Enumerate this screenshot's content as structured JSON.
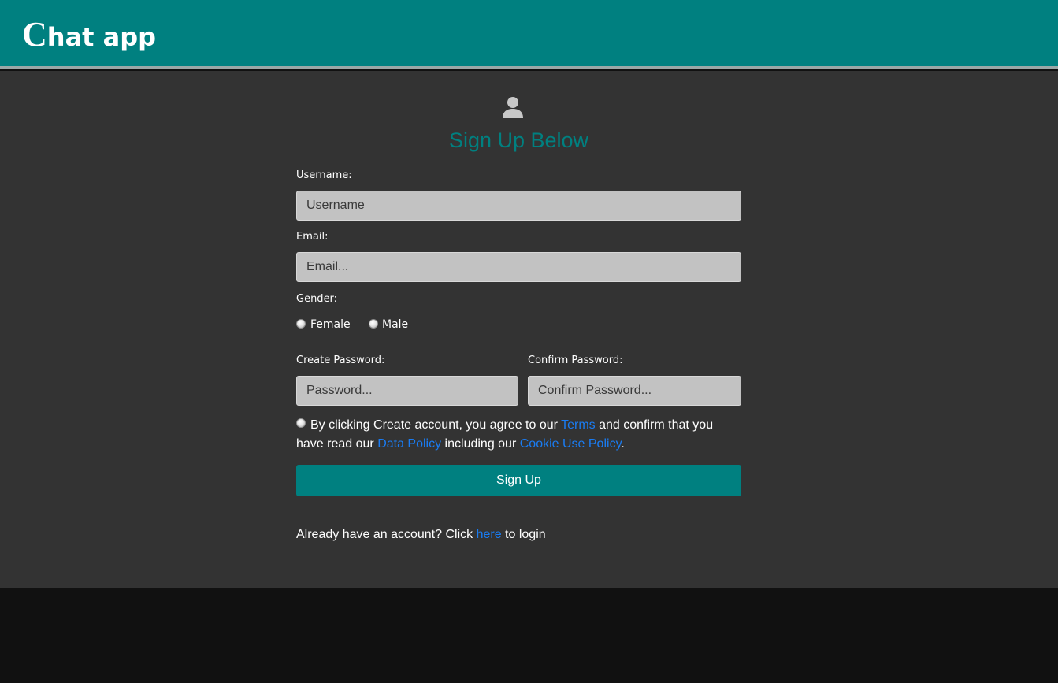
{
  "header": {
    "brand_cap": "C",
    "brand_rest": "hat app"
  },
  "form": {
    "icon": "user-icon",
    "heading": "Sign Up Below",
    "username": {
      "label": "Username:",
      "placeholder": "Username"
    },
    "email": {
      "label": "Email:",
      "placeholder": "Email..."
    },
    "gender": {
      "label": "Gender:",
      "options": [
        "Female",
        "Male"
      ]
    },
    "password": {
      "label": "Create Password:",
      "placeholder": "Password..."
    },
    "confirm_password": {
      "label": "Confirm Password:",
      "placeholder": "Confirm Password..."
    },
    "terms": {
      "part1": "By clicking Create account, you agree to our ",
      "terms_link": "Terms",
      "part2": " and confirm that you have read our ",
      "data_policy_link": "Data Policy",
      "part3": " including our ",
      "cookie_policy_link": "Cookie Use Policy",
      "part4": "."
    },
    "submit_label": "Sign Up",
    "login": {
      "prefix": "Already have an account? Click ",
      "link": "here",
      "suffix": " to login"
    }
  },
  "colors": {
    "accent": "#008080",
    "background": "#333333",
    "link": "#1a7cf2",
    "input_bg": "#c2c2c2"
  }
}
